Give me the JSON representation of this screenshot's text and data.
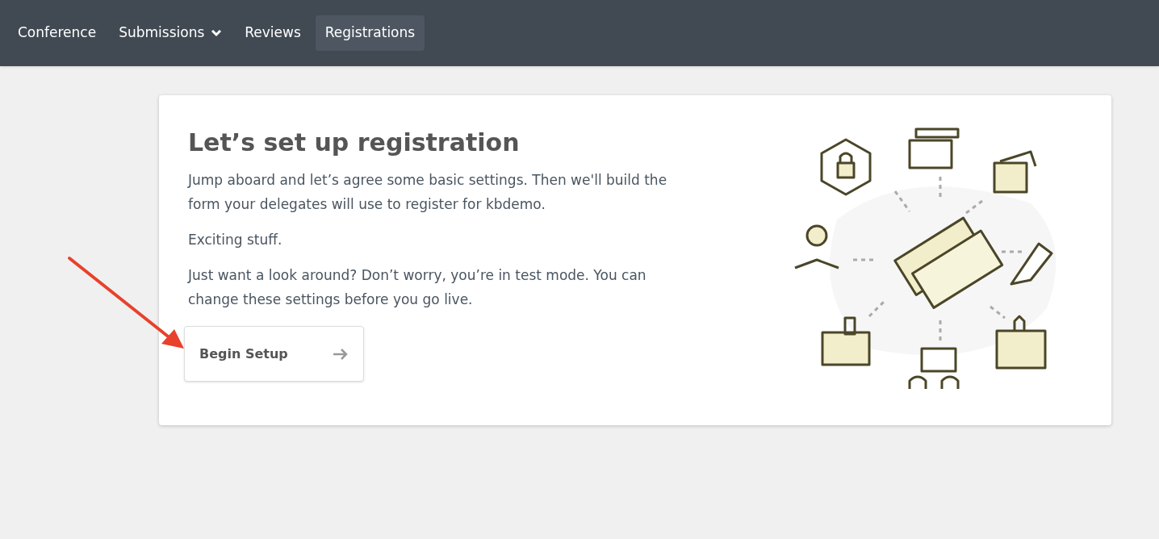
{
  "nav": {
    "items": [
      {
        "label": "Conference",
        "selected": false,
        "dropdown": false
      },
      {
        "label": "Submissions",
        "selected": false,
        "dropdown": true
      },
      {
        "label": "Reviews",
        "selected": false,
        "dropdown": false
      },
      {
        "label": "Registrations",
        "selected": true,
        "dropdown": false
      }
    ]
  },
  "card": {
    "title": "Let’s set up registration",
    "paragraphs": [
      "Jump aboard and let’s agree some basic settings. Then we'll build the form your delegates will use to register for kbdemo.",
      "Exciting stuff.",
      "Just want a look around? Don’t worry, you’re in test mode. You can change these settings before you go live."
    ],
    "button": "Begin Setup"
  }
}
